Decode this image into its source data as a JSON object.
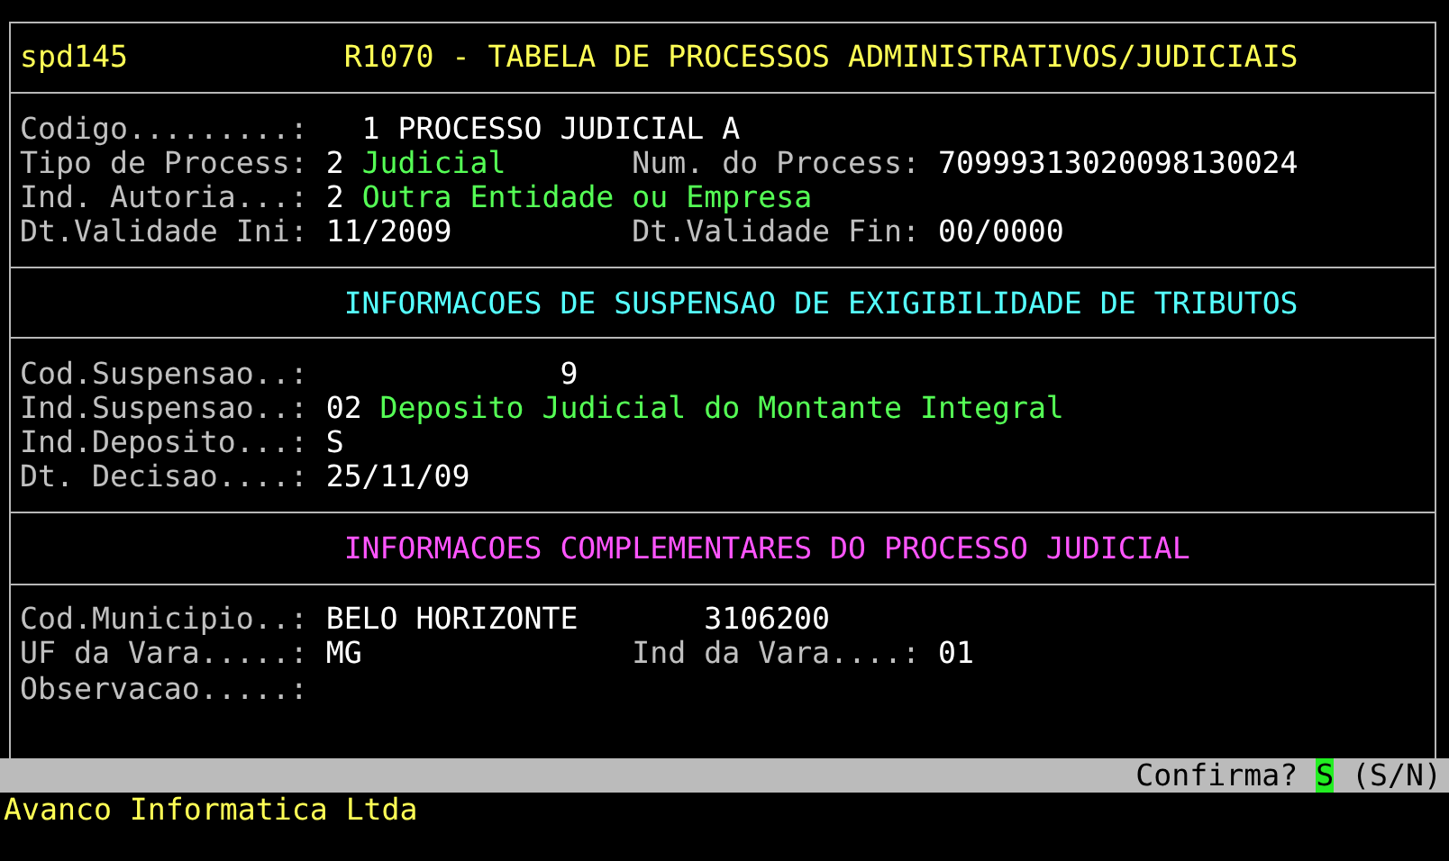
{
  "header": {
    "program": "spd145",
    "title": "R1070 - TABELA DE PROCESSOS ADMINISTRATIVOS/JUDICIAIS"
  },
  "sections": [
    {
      "rows": [
        [
          {
            "kind": "code_title",
            "label": "Codigo.........:",
            "code": "1",
            "text": "PROCESSO JUDICIAL A"
          }
        ],
        [
          {
            "kind": "code_description",
            "label": "Tipo de Process:",
            "code": "2",
            "text": "Judicial"
          },
          {
            "kind": "value",
            "label": "Num. do Process:",
            "text": "70999313020098130024"
          }
        ],
        [
          {
            "kind": "code_description",
            "label": "Ind. Autoria...:",
            "code": "2",
            "text": "Outra Entidade ou Empresa"
          }
        ],
        [
          {
            "kind": "value",
            "label": "Dt.Validade Ini:",
            "text": "11/2009"
          },
          {
            "kind": "value",
            "label": "Dt.Validade Fin:",
            "text": "00/0000"
          }
        ]
      ]
    },
    {
      "title": "INFORMACOES DE SUSPENSAO DE EXIGIBILIDADE DE TRIBUTOS",
      "color": "#55ffff",
      "rows": [
        [
          {
            "kind": "number",
            "label": "Cod.Suspensao..:",
            "text": "9"
          }
        ],
        [
          {
            "kind": "code_description",
            "label": "Ind.Suspensao..:",
            "code": "02",
            "text": "Deposito Judicial do Montante Integral"
          }
        ],
        [
          {
            "kind": "value",
            "label": "Ind.Deposito...:",
            "text": "S"
          }
        ],
        [
          {
            "kind": "value",
            "label": "Dt. Decisao....:",
            "text": "25/11/09"
          }
        ]
      ]
    },
    {
      "title": "INFORMACOES COMPLEMENTARES DO PROCESSO JUDICIAL",
      "color": "#ff55ff",
      "rows": [
        [
          {
            "kind": "value_code",
            "label": "Cod.Municipio..:",
            "text": "BELO HORIZONTE",
            "code": "3106200"
          }
        ],
        [
          {
            "kind": "value",
            "label": "UF da Vara.....:",
            "text": "MG"
          },
          {
            "kind": "value",
            "label": "Ind da Vara....:",
            "text": "01"
          }
        ],
        [
          {
            "kind": "label_only",
            "label": "Observacao.....:"
          }
        ]
      ]
    }
  ],
  "prompt": {
    "label": "Confirma?",
    "answer": "S",
    "options": "(S/N)"
  },
  "footer": "Avanco Informatica Ltda"
}
